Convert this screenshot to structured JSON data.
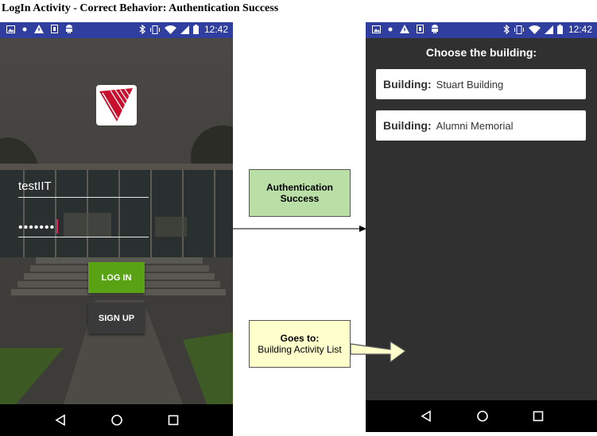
{
  "doc": {
    "title": "LogIn Activity - Correct Behavior: Authentication Success"
  },
  "login_screen": {
    "status_time": "12:42",
    "username_value": "testIIT",
    "password_value": "•••••••",
    "login_button": "LOG IN",
    "signup_button": "SIGN UP"
  },
  "building_screen": {
    "status_time": "12:42",
    "title": "Choose the building:",
    "buildings": [
      {
        "label": "Building:",
        "name": "Stuart Building"
      },
      {
        "label": "Building:",
        "name": "Alumni Memorial"
      }
    ]
  },
  "annotations": {
    "auth": {
      "line1": "Authentication",
      "line2": "Success"
    },
    "goes": {
      "line1": "Goes to:",
      "line2": "Building Activity List"
    }
  },
  "colors": {
    "status_bar": "#303f9f",
    "login_button": "#58a213",
    "signup_button": "#3a3a3a",
    "auth_note": "#b9dfa7",
    "goes_note": "#ffffcc",
    "building_bg": "#303030"
  },
  "icons": {
    "status_left": [
      "image-icon",
      "dot-icon",
      "warning-icon",
      "sim-icon",
      "android-icon"
    ],
    "status_right": [
      "bluetooth-icon",
      "vibrate-icon",
      "wifi-icon",
      "signal-icon",
      "battery-icon"
    ],
    "nav": [
      "back-icon",
      "home-icon",
      "recents-icon"
    ],
    "logo": "iit-logo"
  }
}
